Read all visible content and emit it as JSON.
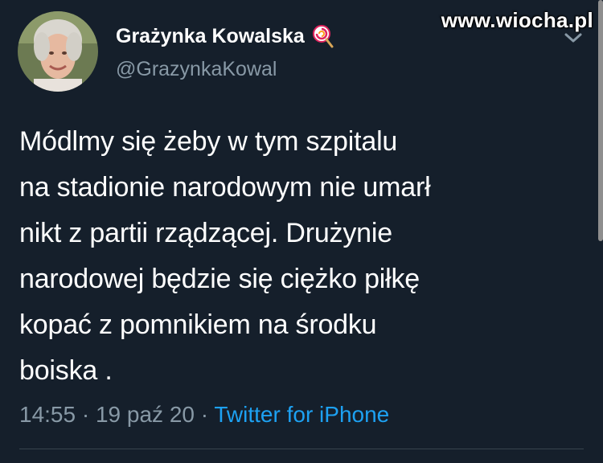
{
  "header": {
    "display_name": "Grażynka Kowalska",
    "handle": "@GrazynkaKowal",
    "name_emoji": "lollipop-icon"
  },
  "watermark": "www.wiocha.pl",
  "tweet": {
    "text": "Módlmy się żeby w tym szpitalu\nna stadionie narodowym nie umarł\nnikt z partii rządzącej. Drużynie\nnarodowej będzie się ciężko piłkę\nkopać z pomnikiem na środku\nboiska ."
  },
  "meta": {
    "time": "14:55",
    "separator": " · ",
    "date": "19 paź 20",
    "source": "Twitter for iPhone"
  },
  "colors": {
    "background": "#151f2b",
    "secondary_text": "#8899a6",
    "link": "#1da1f2",
    "divider": "#38444d"
  }
}
